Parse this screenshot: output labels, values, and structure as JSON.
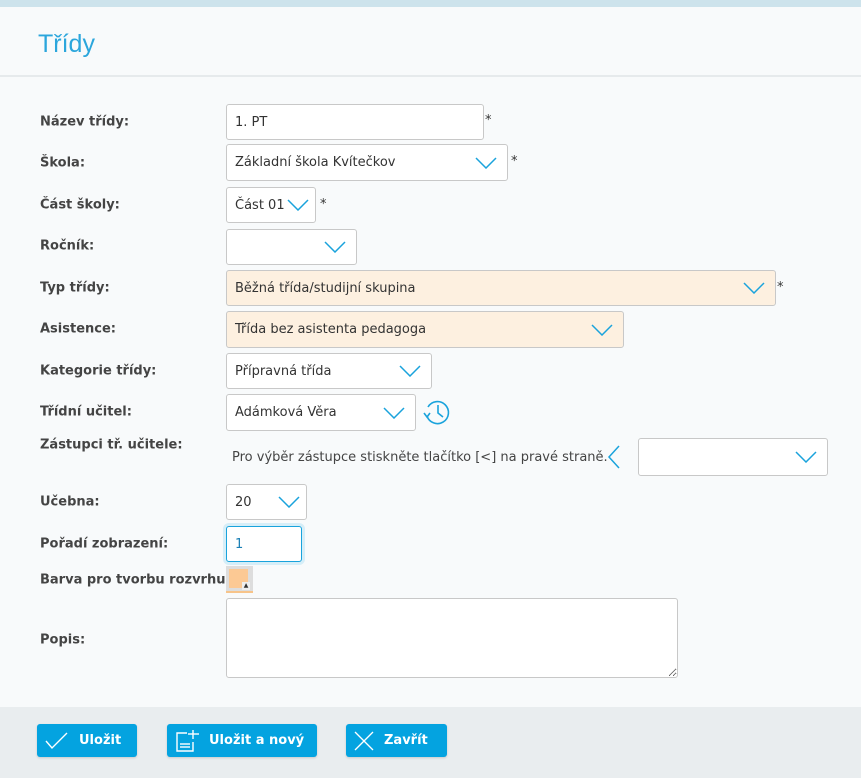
{
  "title": "Třídy",
  "fields": {
    "nazev": {
      "label": "Název třídy:",
      "value": "1. PT",
      "required": "*"
    },
    "skola": {
      "label": "Škola:",
      "value": "Základní škola Kvítečkov",
      "required": "*"
    },
    "cast": {
      "label": "Část školy:",
      "value": "Část 01",
      "required": "*"
    },
    "rocnik": {
      "label": "Ročník:",
      "value": ""
    },
    "typ": {
      "label": "Typ třídy:",
      "value": "Běžná třída/studijní skupina",
      "required": "*"
    },
    "asistence": {
      "label": "Asistence:",
      "value": "Třída bez asistenta pedagoga"
    },
    "kategorie": {
      "label": "Kategorie třídy:",
      "value": "Přípravná třída"
    },
    "ucitel": {
      "label": "Třídní učitel:",
      "value": "Adámková Věra"
    },
    "zastupci": {
      "label": "Zástupci tř. učitele:",
      "hint": "Pro výběr zástupce stiskněte tlačítko [<] na pravé straně.",
      "value": ""
    },
    "ucebna": {
      "label": "Učebna:",
      "value": "20"
    },
    "poradi": {
      "label": "Pořadí zobrazení:",
      "value": "1"
    },
    "barva": {
      "label": "Barva pro tvorbu rozvrhu:",
      "color": "#fcc994"
    },
    "popis": {
      "label": "Popis:",
      "value": ""
    }
  },
  "buttons": {
    "save": "Uložit",
    "save_new": "Uložit a nový",
    "close": "Zavřít"
  },
  "colors": {
    "accent": "#04a3e0",
    "title": "#2ba6dc",
    "highlight": "#fdf0e0"
  }
}
